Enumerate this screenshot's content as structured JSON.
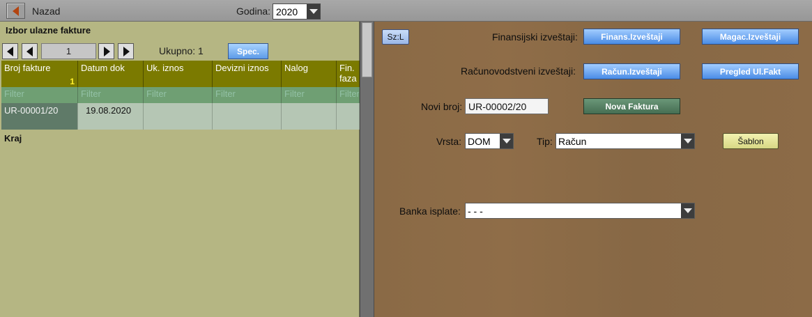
{
  "topbar": {
    "back_label": "Nazad",
    "year_label": "Godina:",
    "year_value": "2020"
  },
  "left": {
    "title": "Izbor ulazne fakture",
    "page_value": "1",
    "count_label": "Ukupno: 1",
    "spec_label": "Spec.",
    "columns": [
      "Broj fakture",
      "Datum dok",
      "Uk. iznos",
      "Devizni iznos",
      "Nalog",
      "Fin. faza"
    ],
    "header_badge": "1",
    "filter_placeholder": "Filter",
    "rows": [
      {
        "broj": "UR-00001/20",
        "datum": "19.08.2020",
        "uk_iznos": "",
        "devizni": "",
        "nalog": "",
        "faza": ""
      }
    ],
    "end_label": "Kraj"
  },
  "right": {
    "szl_label": "Sz:L",
    "finansijski_label": "Finansijski izveštaji:",
    "finans_btn": "Finans.Izveštaji",
    "magac_btn": "Magac.Izveštaji",
    "racunovodstveni_label": "Računovodstveni izveštaji:",
    "racun_btn": "Račun.Izveštaji",
    "pregled_btn": "Pregled Ul.Fakt",
    "novi_broj_label": "Novi broj:",
    "novi_broj_value": "UR-00002/20",
    "nova_faktura_btn": "Nova Faktura",
    "vrsta_label": "Vrsta:",
    "vrsta_value": "DOM",
    "tip_label": "Tip:",
    "tip_value": "Račun",
    "sablon_btn": "Šablon",
    "banka_label": "Banka isplate:",
    "banka_value": "- - -"
  }
}
